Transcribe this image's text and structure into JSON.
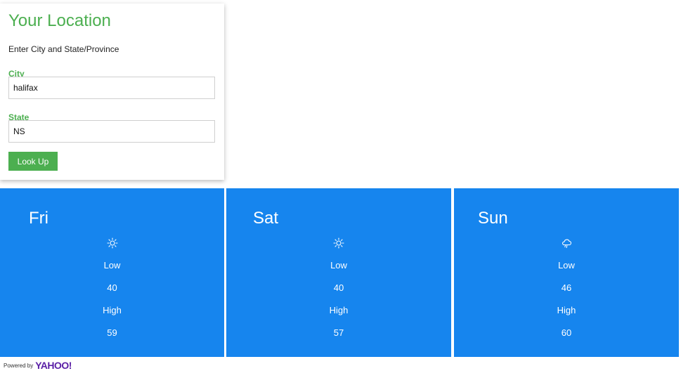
{
  "location_form": {
    "title": "Your Location",
    "instructions": "Enter City and State/Province",
    "city_label": "City",
    "city_value": "halifax",
    "state_label": "State",
    "state_value": "NS",
    "lookup_label": "Look Up"
  },
  "forecast": [
    {
      "day": "Fri",
      "icon": "sun-icon",
      "low_label": "Low",
      "low": "40",
      "high_label": "High",
      "high": "59"
    },
    {
      "day": "Sat",
      "icon": "sun-icon",
      "low_label": "Low",
      "low": "40",
      "high_label": "High",
      "high": "57"
    },
    {
      "day": "Sun",
      "icon": "rain-cloud-icon",
      "low_label": "Low",
      "low": "46",
      "high_label": "High",
      "high": "60"
    }
  ],
  "footer": {
    "powered_by": "Powered by",
    "brand": "YAHOO!"
  },
  "colors": {
    "accent_green": "#4caf50",
    "forecast_blue": "#1685ee",
    "yahoo_purple": "#5a1fa6"
  }
}
